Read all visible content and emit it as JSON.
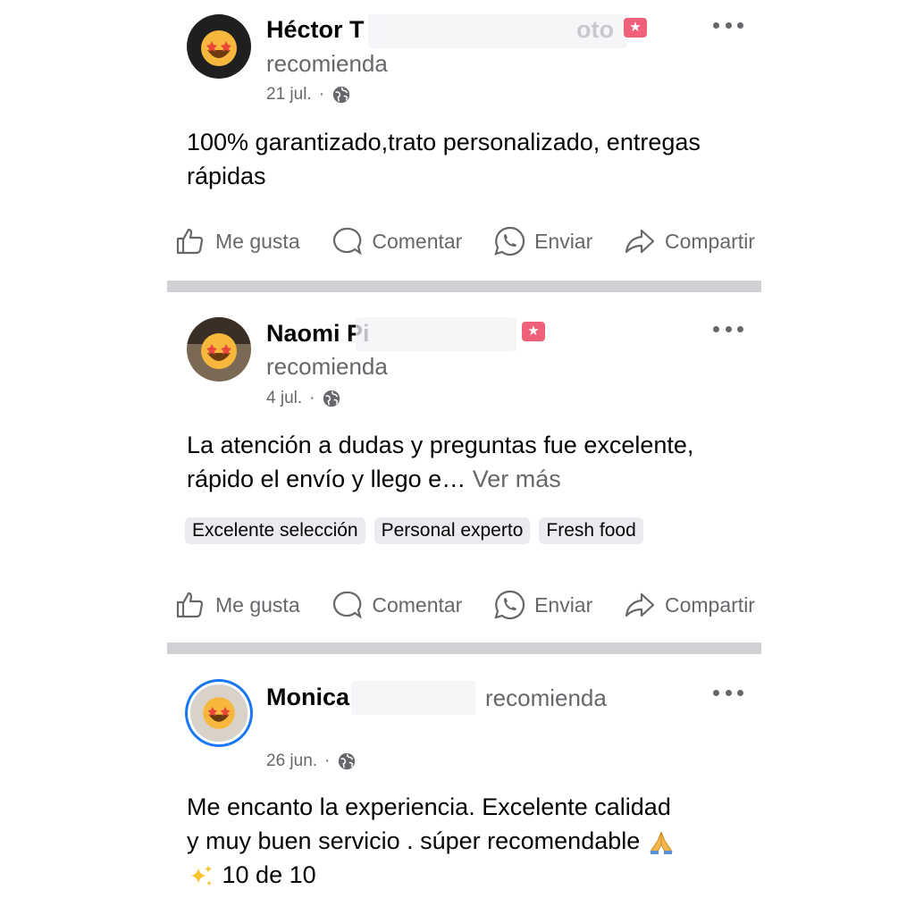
{
  "posts": [
    {
      "author": "Héctor T",
      "author_suffix": "oto",
      "action": "recomienda",
      "date": "21 jul.",
      "text": "100% garantizado,trato personalizado, entregas rápidas",
      "tags": []
    },
    {
      "author": "Naomi Pi",
      "action": "recomienda",
      "date": "4 jul.",
      "text": "La atención a dudas y preguntas fue excelente, rápido el envío y llego e…",
      "see_more": "Ver más",
      "tags": [
        "Excelente selección",
        "Personal experto",
        "Fresh food"
      ]
    },
    {
      "author": "Monica",
      "action": "recomienda",
      "date": "26 jun.",
      "text_line1": "Me encanto la experiencia. Excelente calidad",
      "text_line2": "y muy buen servicio .  súper recomendable",
      "text_line3": "10 de 10"
    }
  ],
  "actions": {
    "like": "Me gusta",
    "comment": "Comentar",
    "send": "Enviar",
    "share": "Compartir"
  },
  "icons": {
    "avatar_overlay": "star-struck-emoji-icon",
    "badge": "recommend-star-badge-icon",
    "privacy": "globe-icon",
    "more": "more-options-icon",
    "like": "thumbs-up-icon",
    "comment": "comment-bubble-icon",
    "send": "whatsapp-icon",
    "share": "share-arrow-icon",
    "pray": "folded-hands-emoji",
    "sparkles": "sparkles-emoji"
  },
  "colors": {
    "badge": "#f0607a",
    "secondary_text": "#65676b",
    "divider": "#cfd1d5",
    "story_ring": "#1877f2"
  }
}
